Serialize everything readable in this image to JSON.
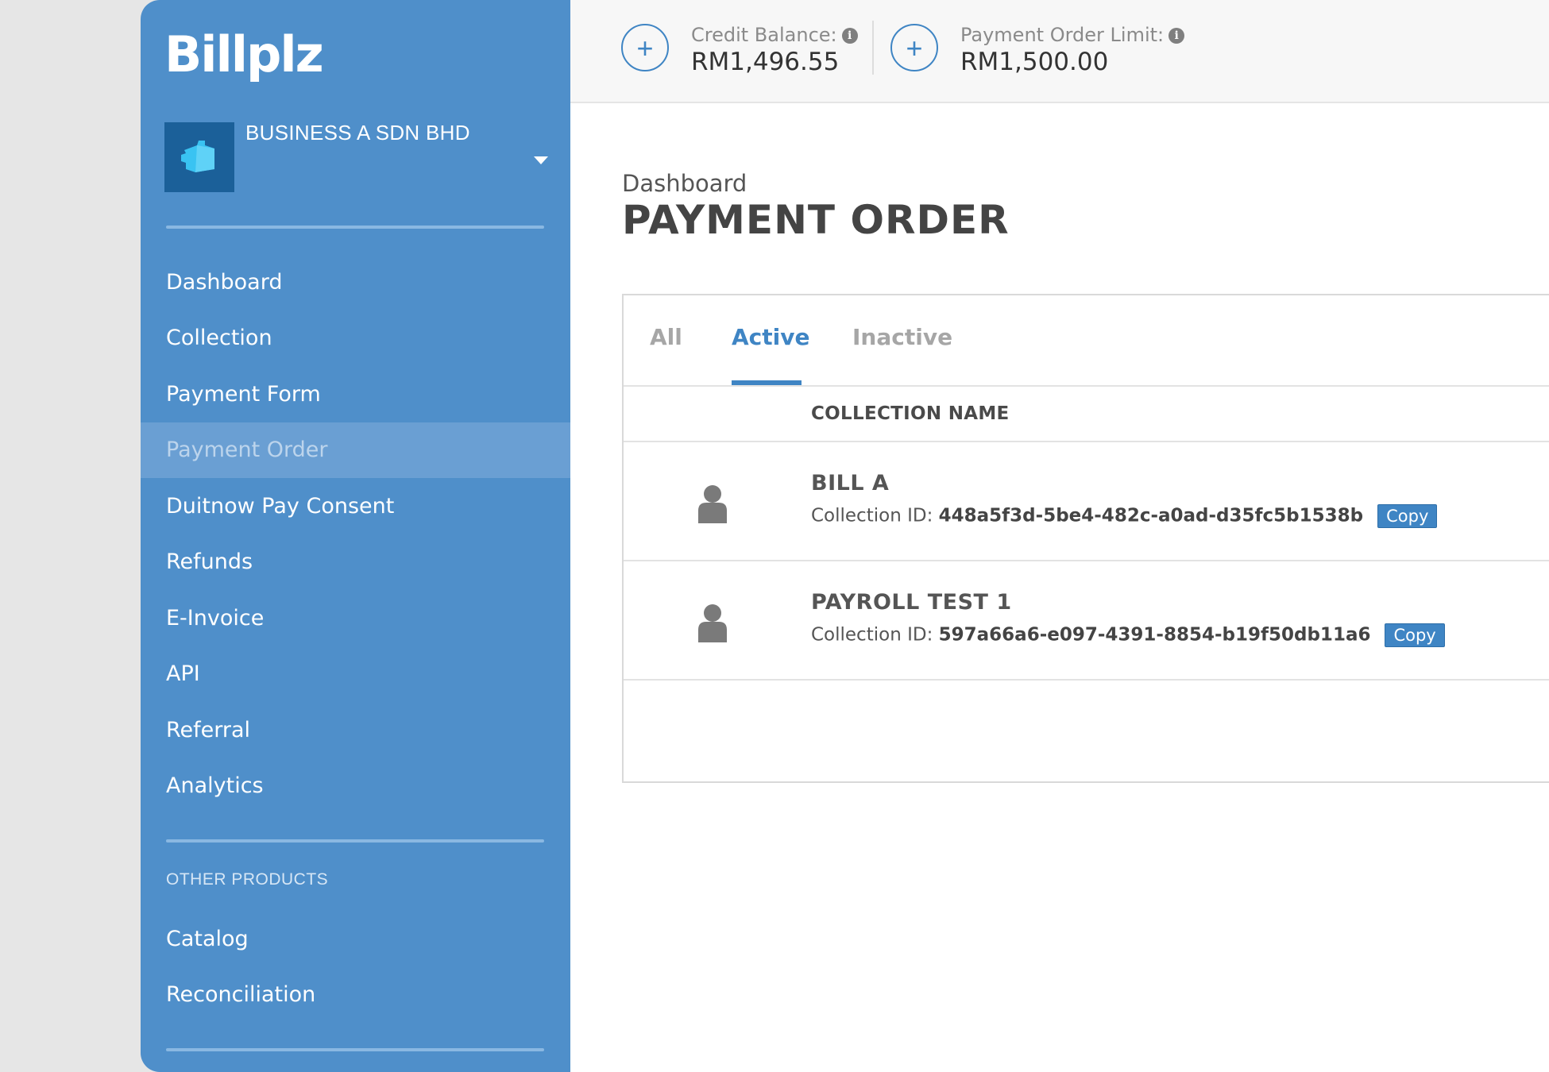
{
  "app": {
    "logo_text": "Billplz"
  },
  "business": {
    "name": "BUSINESS A SDN BHD"
  },
  "sidebar": {
    "items": [
      {
        "label": "Dashboard"
      },
      {
        "label": "Collection"
      },
      {
        "label": "Payment Form"
      },
      {
        "label": "Payment Order",
        "active": true
      },
      {
        "label": "Duitnow Pay Consent"
      },
      {
        "label": "Refunds"
      },
      {
        "label": "E-Invoice"
      },
      {
        "label": "API"
      },
      {
        "label": "Referral"
      },
      {
        "label": "Analytics"
      }
    ],
    "other_products_label": "OTHER PRODUCTS",
    "other_items": [
      {
        "label": "Catalog"
      },
      {
        "label": "Reconciliation"
      }
    ]
  },
  "topbar": {
    "credit_balance_label": "Credit Balance:",
    "credit_balance_value": "RM1,496.55",
    "payment_order_limit_label": "Payment Order Limit:",
    "payment_order_limit_value": "RM1,500.00",
    "add_symbol": "+",
    "info_symbol": "i"
  },
  "page": {
    "breadcrumb": "Dashboard",
    "title": "PAYMENT ORDER"
  },
  "tabs": [
    {
      "label": "All"
    },
    {
      "label": "Active",
      "active": true
    },
    {
      "label": "Inactive"
    }
  ],
  "table": {
    "column_header": "COLLECTION NAME",
    "id_prefix": "Collection ID:",
    "copy_label": "Copy",
    "rows": [
      {
        "name": "BILL A",
        "collection_id": "448a5f3d-5be4-482c-a0ad-d35fc5b1538b"
      },
      {
        "name": "PAYROLL TEST 1",
        "collection_id": "597a66a6-e097-4391-8854-b19f50db11a6"
      }
    ]
  },
  "colors": {
    "sidebar_bg": "#4f8fca",
    "accent": "#3f85c4",
    "active_nav_bg": "#6a9fd3"
  }
}
